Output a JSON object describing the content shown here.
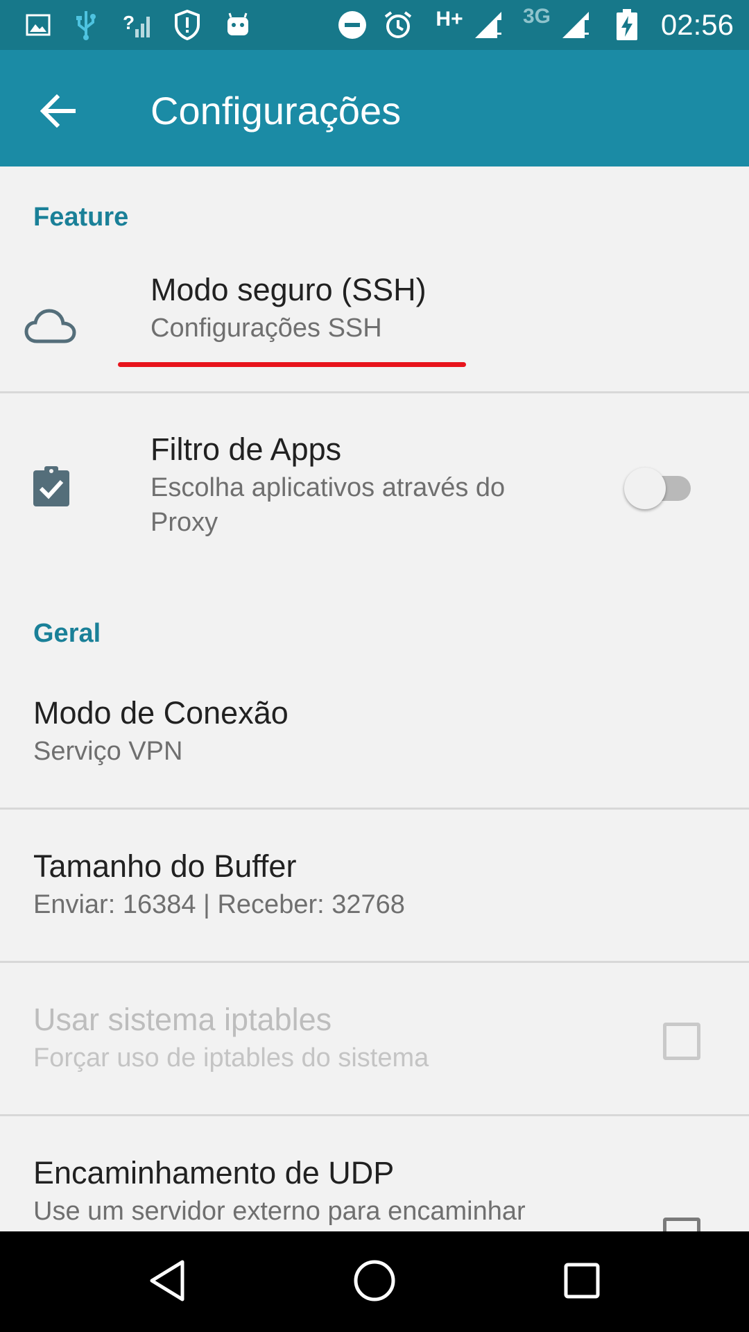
{
  "status_bar": {
    "time": "02:56",
    "network_type_1": "H+",
    "network_type_2": "3G",
    "icons": [
      "image-icon",
      "usb-icon",
      "signal-unknown-icon",
      "shield-alert-icon",
      "android-icon",
      "do-not-disturb-icon",
      "alarm-icon",
      "signal-icon",
      "signal-icon",
      "battery-charging-icon"
    ]
  },
  "app_bar": {
    "title": "Configurações",
    "back_icon": "arrow-back-icon"
  },
  "sections": {
    "feature_header": "Feature",
    "general_header": "Geral"
  },
  "prefs": {
    "ssh": {
      "title": "Modo seguro (SSH)",
      "summary": "Configurações SSH",
      "icon": "cloud-icon"
    },
    "app_filter": {
      "title": "Filtro de Apps",
      "summary": "Escolha aplicativos através do Proxy",
      "icon": "clipboard-check-icon",
      "enabled": false
    },
    "connection_mode": {
      "title": "Modo de Conexão",
      "summary": "Serviço VPN"
    },
    "buffer_size": {
      "title": "Tamanho do Buffer",
      "summary": "Enviar: 16384 | Receber: 32768"
    },
    "iptables": {
      "title": "Usar sistema iptables",
      "summary": "Forçar uso de iptables do sistema",
      "checked": false,
      "disabled": true
    },
    "udp_forward": {
      "title": "Encaminhamento de UDP",
      "summary": "Use um servidor externo para encaminhar"
    }
  },
  "nav_bar": {
    "icons": [
      "back-triangle-icon",
      "home-circle-icon",
      "recents-square-icon"
    ]
  },
  "colors": {
    "status_bar": "#17788a",
    "app_bar": "#1b8ba5",
    "accent": "#1a8098",
    "annotation": "#e8141c"
  }
}
